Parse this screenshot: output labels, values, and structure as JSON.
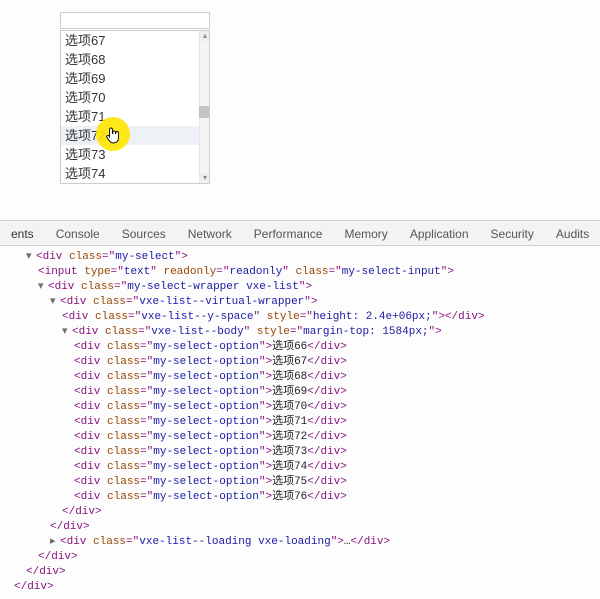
{
  "select_input_value": "",
  "options": [
    {
      "label": "选项67"
    },
    {
      "label": "选项68"
    },
    {
      "label": "选项69"
    },
    {
      "label": "选项70"
    },
    {
      "label": "选项71"
    },
    {
      "label": "选项72",
      "hover": true
    },
    {
      "label": "选项73"
    },
    {
      "label": "选项74"
    }
  ],
  "devtools_tabs": {
    "elements": "ents",
    "console": "Console",
    "sources": "Sources",
    "network": "Network",
    "performance": "Performance",
    "memory": "Memory",
    "application": "Application",
    "security": "Security",
    "audits": "Audits"
  },
  "code": {
    "div": "div",
    "input": "input",
    "class": "class",
    "type": "type",
    "readonly": "readonly",
    "style": "style",
    "my_select": "my-select",
    "text": "text",
    "my_select_input": "my-select-input",
    "my_select_wrapper": "my-select-wrapper vxe-list",
    "virtual_wrapper": "vxe-list--virtual-wrapper",
    "y_space": "vxe-list--y-space",
    "y_space_style": "height: 2.4e+06px;",
    "body": "vxe-list--body",
    "body_style": "margin-top: 1584px;",
    "opt_cls": "my-select-option",
    "loading": "vxe-list--loading vxe-loading",
    "opts": [
      "选项66",
      "选项67",
      "选项68",
      "选项69",
      "选项70",
      "选项71",
      "选项72",
      "选项73",
      "选项74",
      "选项75",
      "选项76"
    ],
    "ellipsis": "…"
  }
}
